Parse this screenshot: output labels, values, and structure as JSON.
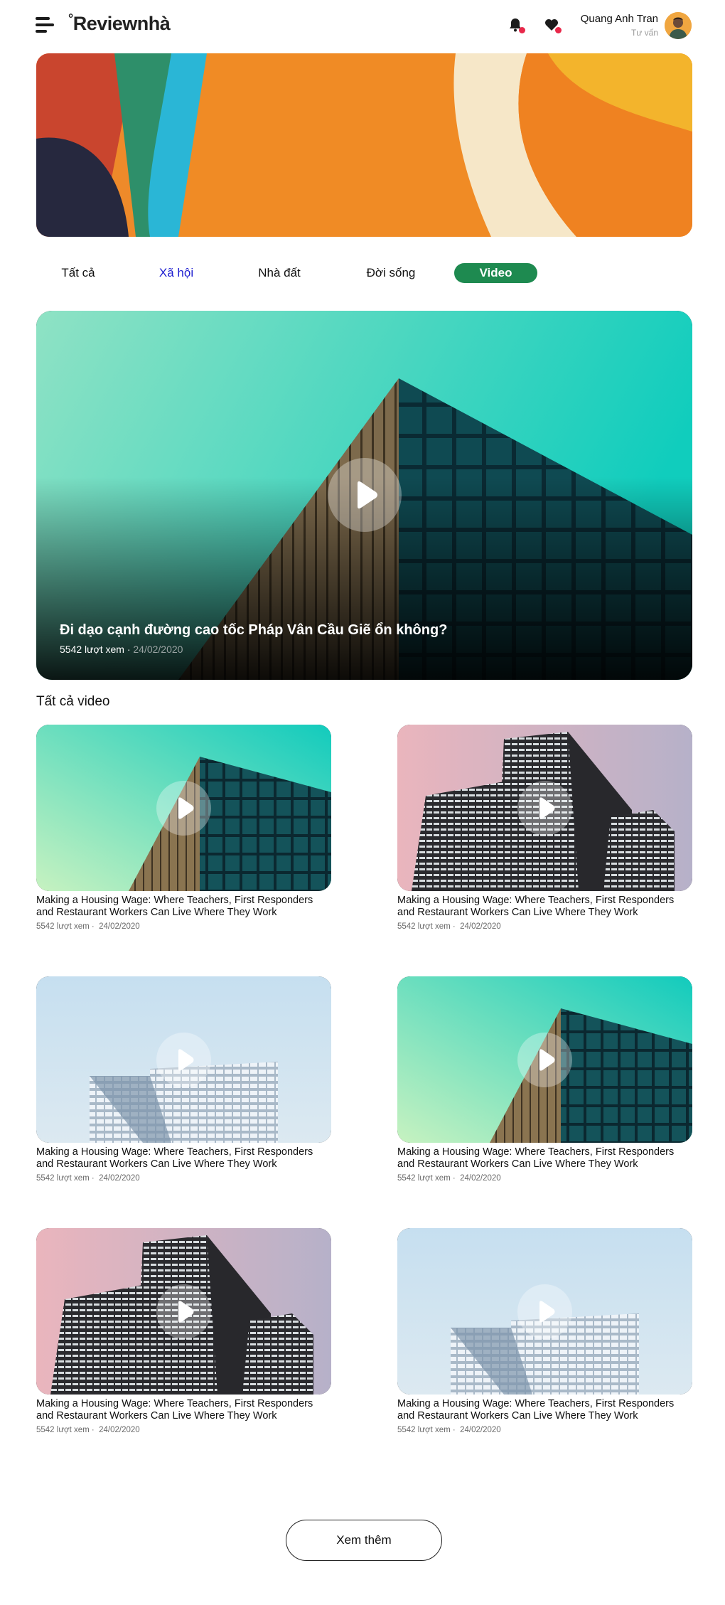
{
  "header": {
    "logo": "Reviewnhà",
    "logo_mark": "°",
    "user_name": "Quang Anh Tran",
    "user_role": "Tư vấn",
    "icons": [
      "menu-icon",
      "bell-icon",
      "heart-icon"
    ]
  },
  "tabs": [
    "Tất cả",
    "Xã hội",
    "Nhà đất",
    "Đời sống",
    "Video"
  ],
  "featured": {
    "title": "Đi dạo cạnh đường cao tốc Pháp Vân Cầu Giẽ ổn không?",
    "views": "5542 lượt xem ·",
    "date": "24/02/2020"
  },
  "section_title": "Tất cả video",
  "videos": [
    {
      "title": "Making a Housing Wage: Where Teachers, First Responders and Restaurant Workers Can Live Where They Work",
      "views": "5542 lượt xem ·",
      "date": "24/02/2020",
      "theme": "teal"
    },
    {
      "title": "Making a Housing Wage: Where Teachers, First Responders and Restaurant Workers Can Live Where They Work",
      "views": "5542 lượt xem ·",
      "date": "24/02/2020",
      "theme": "pink"
    },
    {
      "title": "Making a Housing Wage: Where Teachers, First Responders and Restaurant Workers Can Live Where They Work",
      "views": "5542 lượt xem ·",
      "date": "24/02/2020",
      "theme": "blue"
    },
    {
      "title": "Making a Housing Wage: Where Teachers, First Responders and Restaurant Workers Can Live Where They Work",
      "views": "5542 lượt xem ·",
      "date": "24/02/2020",
      "theme": "teal"
    },
    {
      "title": "Making a Housing Wage: Where Teachers, First Responders and Restaurant Workers Can Live Where They Work",
      "views": "5542 lượt xem ·",
      "date": "24/02/2020",
      "theme": "pink"
    },
    {
      "title": "Making a Housing Wage: Where Teachers, First Responders and Restaurant Workers Can Live Where They Work",
      "views": "5542 lượt xem ·",
      "date": "24/02/2020",
      "theme": "blue"
    }
  ],
  "load_more": "Xem thêm",
  "colors": {
    "accent_green": "#1e8a50",
    "link_blue": "#1f1fd0",
    "notification_red": "#e8284a"
  }
}
